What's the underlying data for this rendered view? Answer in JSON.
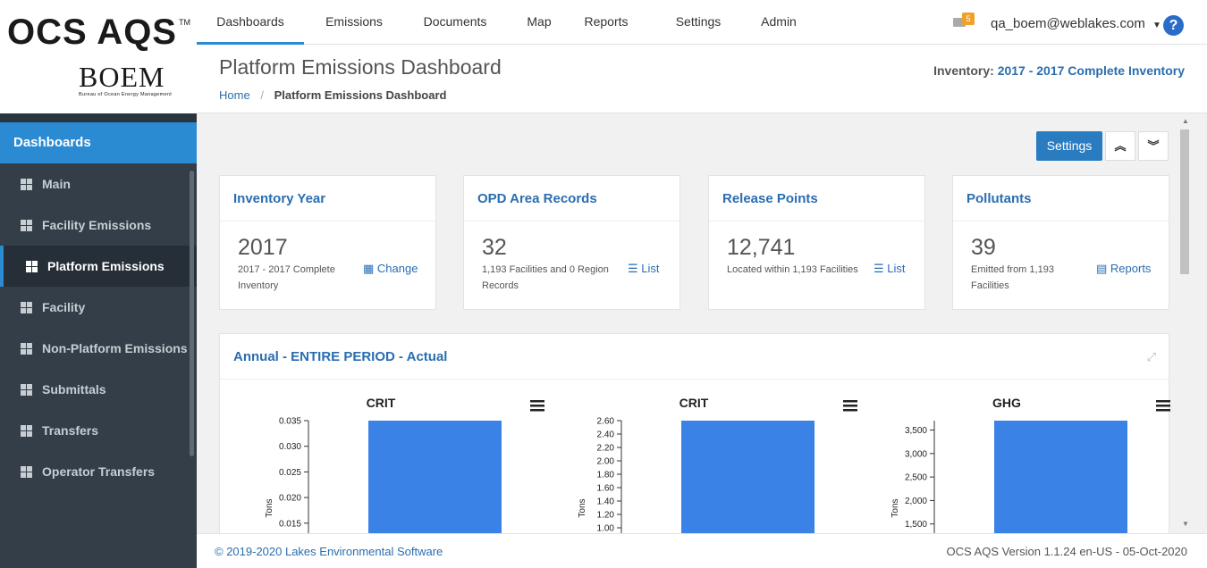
{
  "brand": {
    "app_name": "OCS AQS",
    "trademark": "TM",
    "agency_logo": "BOEM",
    "agency_full": "Bureau of Ocean Energy Management"
  },
  "topnav": {
    "tabs": [
      {
        "label": "Dashboards",
        "active": true
      },
      {
        "label": "Emissions"
      },
      {
        "label": "Documents"
      },
      {
        "label": "Map"
      },
      {
        "label": "Reports"
      },
      {
        "label": "Settings"
      },
      {
        "label": "Admin"
      }
    ],
    "mail_count": "5",
    "user": "qa_boem@weblakes.com",
    "help": "?"
  },
  "sidebar": {
    "section": "Dashboards",
    "items": [
      {
        "label": "Main"
      },
      {
        "label": "Facility Emissions"
      },
      {
        "label": "Platform Emissions",
        "active": true
      },
      {
        "label": "Facility"
      },
      {
        "label": "Non-Platform Emissions"
      },
      {
        "label": "Submittals"
      },
      {
        "label": "Transfers"
      },
      {
        "label": "Operator Transfers"
      }
    ]
  },
  "header": {
    "title": "Platform Emissions Dashboard",
    "breadcrumb_home": "Home",
    "breadcrumb_sep": "/",
    "breadcrumb_current": "Platform Emissions Dashboard",
    "inventory_label": "Inventory:",
    "inventory_value": "2017 - 2017 Complete Inventory"
  },
  "toolbar": {
    "settings_label": "Settings",
    "collapse_icon": "double-chevron-up-icon",
    "expand_icon": "double-chevron-down-icon"
  },
  "cards": [
    {
      "title": "Inventory Year",
      "value": "2017",
      "detail": "2017 - 2017 Complete Inventory",
      "link": "Change",
      "icon": "calendar-icon"
    },
    {
      "title": "OPD Area Records",
      "value": "32",
      "detail": "1,193 Facilities and 0 Region Records",
      "link": "List",
      "icon": "list-icon"
    },
    {
      "title": "Release Points",
      "value": "12,741",
      "detail": "Located within 1,193 Facilities",
      "link": "List",
      "icon": "list-icon"
    },
    {
      "title": "Pollutants",
      "value": "39",
      "detail": "Emitted from 1,193 Facilities",
      "link": "Reports",
      "icon": "file-icon"
    }
  ],
  "panel": {
    "title": "Annual - ENTIRE PERIOD - Actual"
  },
  "chart_data": [
    {
      "type": "bar",
      "title": "CRIT",
      "ylabel": "Tons",
      "ytick_labels": [
        "0.035",
        "0.030",
        "0.025",
        "0.020",
        "0.015"
      ],
      "ylim": [
        0.0,
        0.035
      ],
      "values": [
        0.035
      ],
      "color": "#3b82e6"
    },
    {
      "type": "bar",
      "title": "CRIT",
      "ylabel": "Tons",
      "ytick_labels": [
        "2.60",
        "2.40",
        "2.20",
        "2.00",
        "1.80",
        "1.60",
        "1.40",
        "1.20",
        "1.00"
      ],
      "ylim": [
        0.0,
        2.6
      ],
      "values": [
        2.6
      ],
      "color": "#3b82e6"
    },
    {
      "type": "bar",
      "title": "GHG",
      "ylabel": "Tons",
      "ytick_labels": [
        "3,500",
        "3,000",
        "2,500",
        "2,000",
        "1,500"
      ],
      "ylim": [
        0,
        3700
      ],
      "values": [
        3700
      ],
      "color": "#3b82e6"
    }
  ],
  "footer": {
    "copyright": "© 2019-2020 Lakes Environmental Software",
    "version": "OCS AQS Version 1.1.24 en-US - 05-Oct-2020"
  }
}
